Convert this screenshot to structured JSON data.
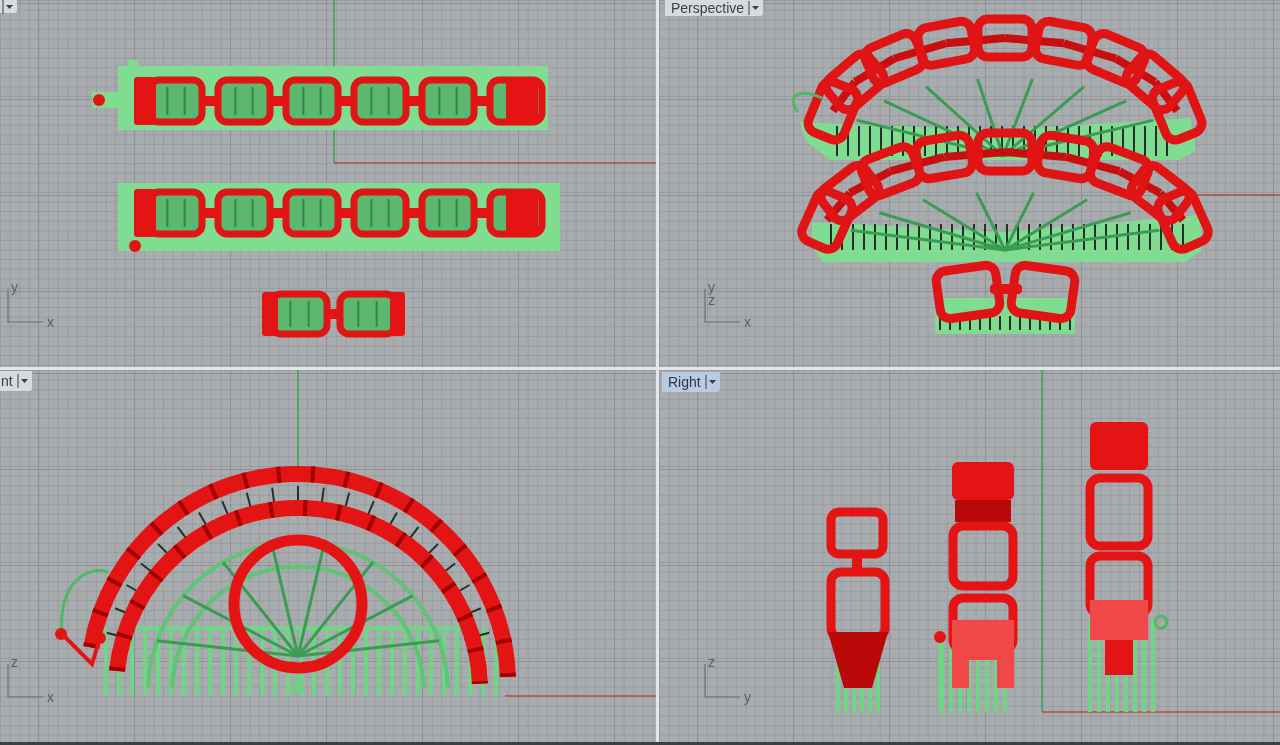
{
  "viewport_rows": [
    {
      "viewports": [
        {
          "kind": "top",
          "selected": false,
          "axes": [
            "y",
            "x"
          ]
        },
        {
          "kind": "perspective",
          "label": "Perspective",
          "selected": false,
          "axes": [
            "y",
            "z",
            "x"
          ]
        }
      ]
    },
    {
      "viewports": [
        {
          "kind": "front",
          "label": "nt",
          "selected": false,
          "axes": [
            "z",
            "x"
          ]
        },
        {
          "kind": "right",
          "label": "Right",
          "selected": true,
          "axes": [
            "z",
            "y"
          ]
        }
      ]
    }
  ]
}
